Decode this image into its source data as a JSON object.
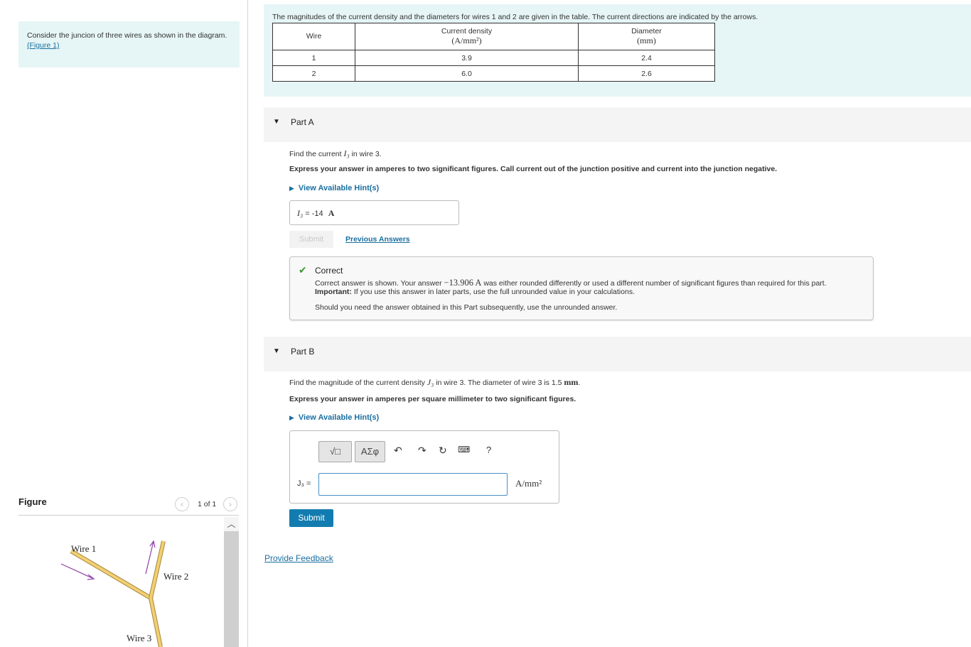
{
  "intro": {
    "text": "Consider the juncion of three wires as shown in the diagram.",
    "figure_link": "(Figure 1)"
  },
  "figure": {
    "title": "Figure",
    "pager_text": "1 of 1",
    "labels": {
      "wire1": "Wire 1",
      "wire2": "Wire 2",
      "wire3": "Wire 3"
    }
  },
  "statement": {
    "text": "The magnitudes of the current density and the diameters for wires 1 and 2 are given in the table. The current directions are indicated by the arrows.",
    "headers": {
      "wire": "Wire",
      "density": "Current density",
      "density_unit": "(A/mm²)",
      "diameter": "Diameter",
      "diameter_unit": "(mm)"
    },
    "rows": [
      {
        "wire": "1",
        "density": "3.9",
        "diameter": "2.4"
      },
      {
        "wire": "2",
        "density": "6.0",
        "diameter": "2.6"
      }
    ]
  },
  "partA": {
    "label": "Part A",
    "question_pre": "Find the current",
    "question_var": "I₃",
    "question_post": "in wire 3.",
    "instruction": "Express your answer in amperes to two significant figures. Call current out of the junction positive and current into the junction negative.",
    "hint": "View Available Hint(s)",
    "answer_var": "I₃",
    "answer_eq": "=",
    "answer_value": "-14",
    "answer_unit": "A",
    "submit_label": "Submit",
    "prev_answers": "Previous Answers",
    "feedback": {
      "title": "Correct",
      "line1_pre": "Correct answer is shown. Your answer",
      "line1_value": "−13.906 A",
      "line1_post": "was either rounded differently or used a different number of significant figures than required for this part.",
      "important_label": "Important:",
      "important_text": "If you use this answer in later parts, use the full unrounded value in your calculations.",
      "line3": "Should you need the answer obtained in this Part subsequently, use the unrounded answer."
    }
  },
  "partB": {
    "label": "Part B",
    "question_pre": "Find the magnitude of the current density",
    "question_var": "J₃",
    "question_post": "in wire 3. The diameter of wire 3 is 1.5",
    "question_unit": "mm",
    "instruction": "Express your answer in amperes per square millimeter to two significant figures.",
    "hint": "View Available Hint(s)",
    "toolbar": {
      "templates": "√□",
      "symbols": "ΑΣφ",
      "help": "?"
    },
    "eq_label": "J₃ =",
    "eq_unit": "A/mm²",
    "submit_label": "Submit"
  },
  "provide_feedback": "Provide Feedback"
}
